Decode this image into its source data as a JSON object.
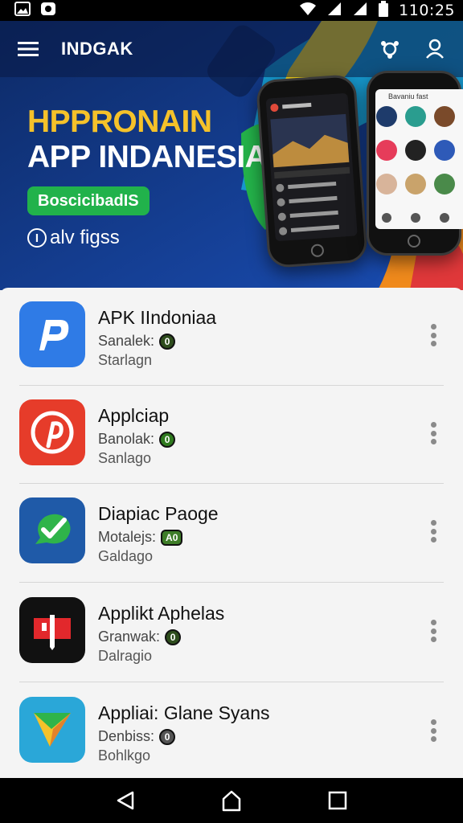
{
  "status_bar": {
    "time": "110:25",
    "left_icons": [
      "image-icon",
      "notification-icon"
    ],
    "right_icons": [
      "wifi-icon",
      "signal-icon",
      "signal-icon",
      "battery-icon"
    ]
  },
  "toolbar": {
    "title": "INDGAK",
    "menu_icon": "hamburger-menu-icon",
    "share_icon": "share-icon",
    "profile_icon": "person-icon"
  },
  "hero": {
    "title_line1": "HPPRONAIN",
    "title_line2": "APP INDANESIA",
    "badge_text": "BoscicibadIS",
    "sub_prefix": "I",
    "sub_text": "alv figss",
    "phone_right_header": "Bavaniu fast",
    "colors": {
      "accent_yellow": "#f5c22a",
      "badge_green": "#21b24b",
      "hero_blue": "#123a8a"
    }
  },
  "apps": [
    {
      "name": "APK IIndoniaa",
      "meta_label": "Sanalek:",
      "meta_badge": "0",
      "sub": "Starlagn",
      "icon": "p-logo-icon",
      "icon_color": "#2f7be6"
    },
    {
      "name": "Applciap",
      "meta_label": "Banolak:",
      "meta_badge": "0",
      "sub": "Sanlago",
      "icon": "pinterest-p-icon",
      "icon_color": "#e63c2a"
    },
    {
      "name": "Diapiac Paoge",
      "meta_label": "Motalejs:",
      "meta_badge": "A0",
      "sub": "Galdago",
      "icon": "check-bubble-icon",
      "icon_color": "#1f5aa8"
    },
    {
      "name": "Applikt Aphelas",
      "meta_label": "Granwak:",
      "meta_badge": "0",
      "sub": "Dalragio",
      "icon": "red-tag-icon",
      "icon_color": "#111111"
    },
    {
      "name": "Appliai: Glane Syans",
      "meta_label": "Denbiss:",
      "meta_badge": "0",
      "sub": "Bohlkgo",
      "icon": "arrow-plane-icon",
      "icon_color": "#2aa7d8"
    }
  ],
  "nav_bar": {
    "back_icon": "back-triangle-icon",
    "home_icon": "home-icon",
    "recents_icon": "recents-square-icon"
  }
}
